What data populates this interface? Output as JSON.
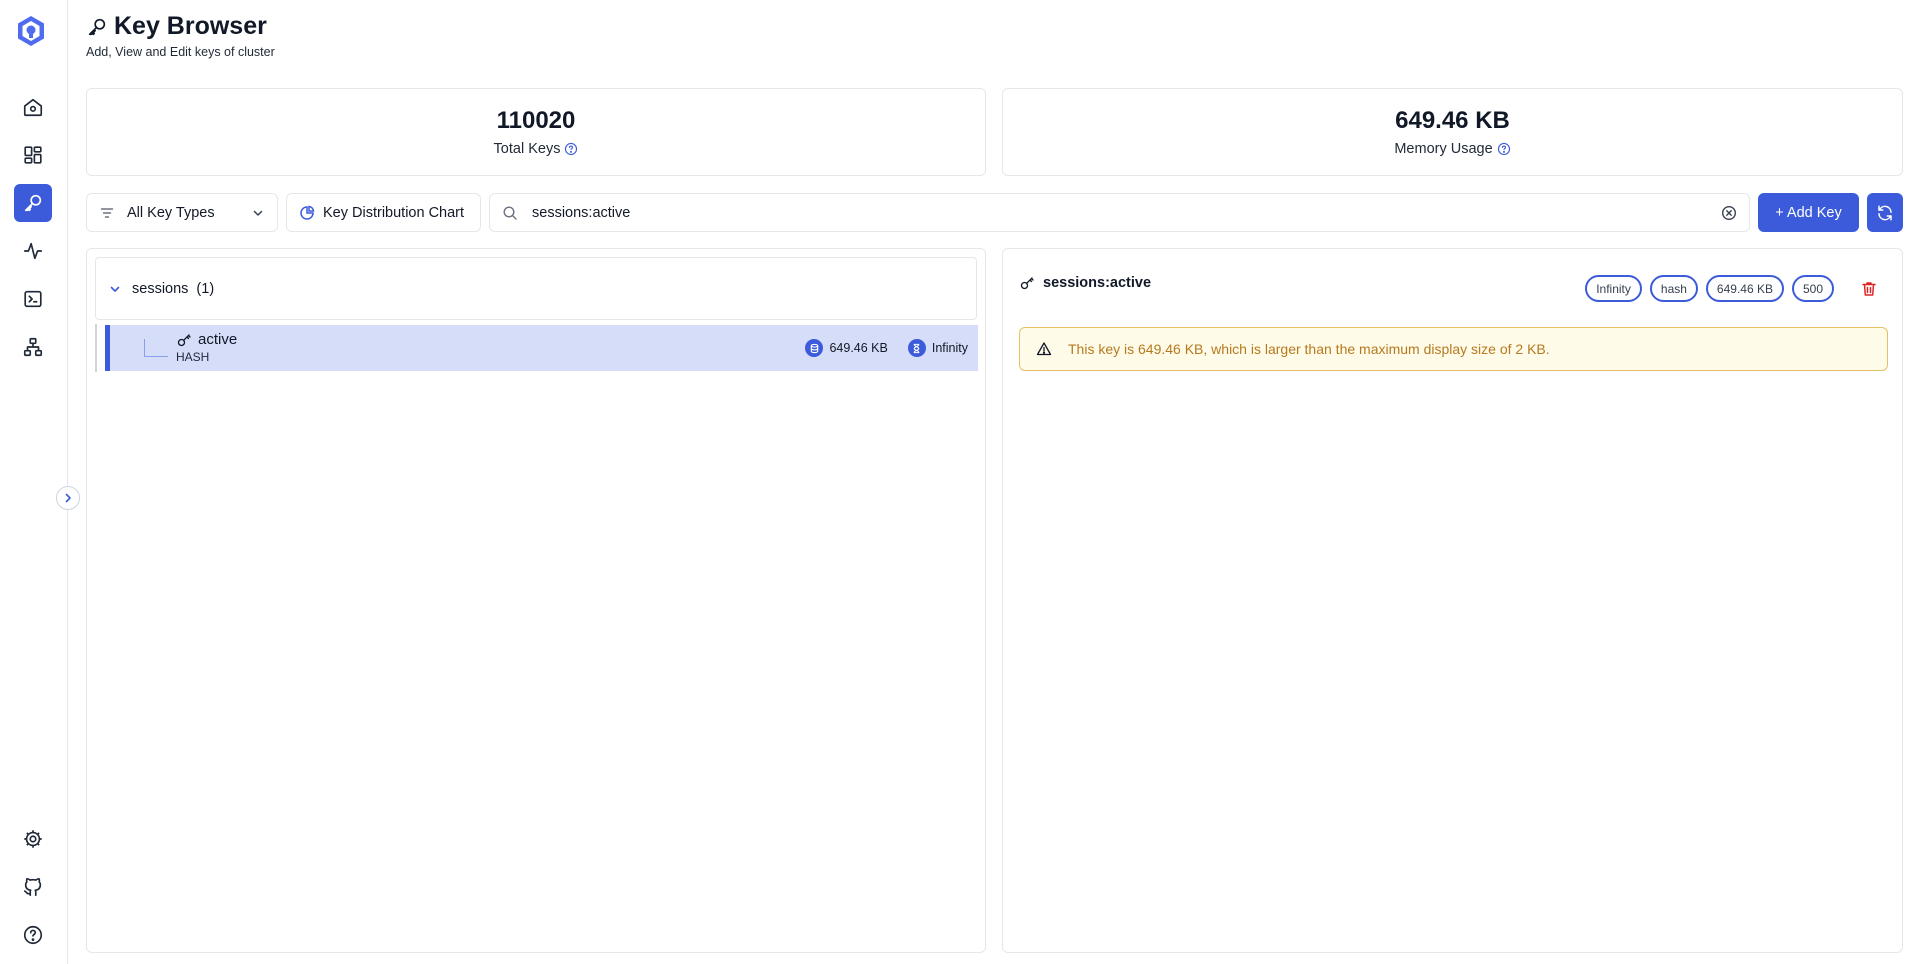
{
  "header": {
    "title": "Key Browser",
    "subtitle": "Add, View and Edit keys of cluster"
  },
  "stats": {
    "total_keys": {
      "value": "110020",
      "label": "Total Keys"
    },
    "memory_usage": {
      "value": "649.46 KB",
      "label": "Memory Usage"
    }
  },
  "toolbar": {
    "filter_label": "All Key Types",
    "chart_label": "Key Distribution Chart",
    "search_value": "sessions:active",
    "add_label": "+ Add Key"
  },
  "tree": {
    "group": {
      "name": "sessions",
      "count": "(1)"
    },
    "key": {
      "name": "active",
      "type": "HASH",
      "size": "649.46 KB",
      "ttl": "Infinity"
    }
  },
  "detail": {
    "key_name": "sessions:active",
    "badges": [
      "Infinity",
      "hash",
      "649.46 KB",
      "500"
    ],
    "warning": "This key is 649.46 KB, which is larger than the maximum display size of 2 KB."
  },
  "colors": {
    "accent": "#3b5bdb",
    "selected_row": "#d6ddf8",
    "warning_text": "#b7791f",
    "warning_bg": "#fefbe8",
    "danger": "#dc2626"
  },
  "icons": {
    "sidebar": [
      "logo-icon",
      "dashboard-home-icon",
      "widgets-icon",
      "key-icon",
      "activity-icon",
      "terminal-icon",
      "cluster-icon",
      "settings-icon",
      "github-icon",
      "help-icon"
    ]
  }
}
